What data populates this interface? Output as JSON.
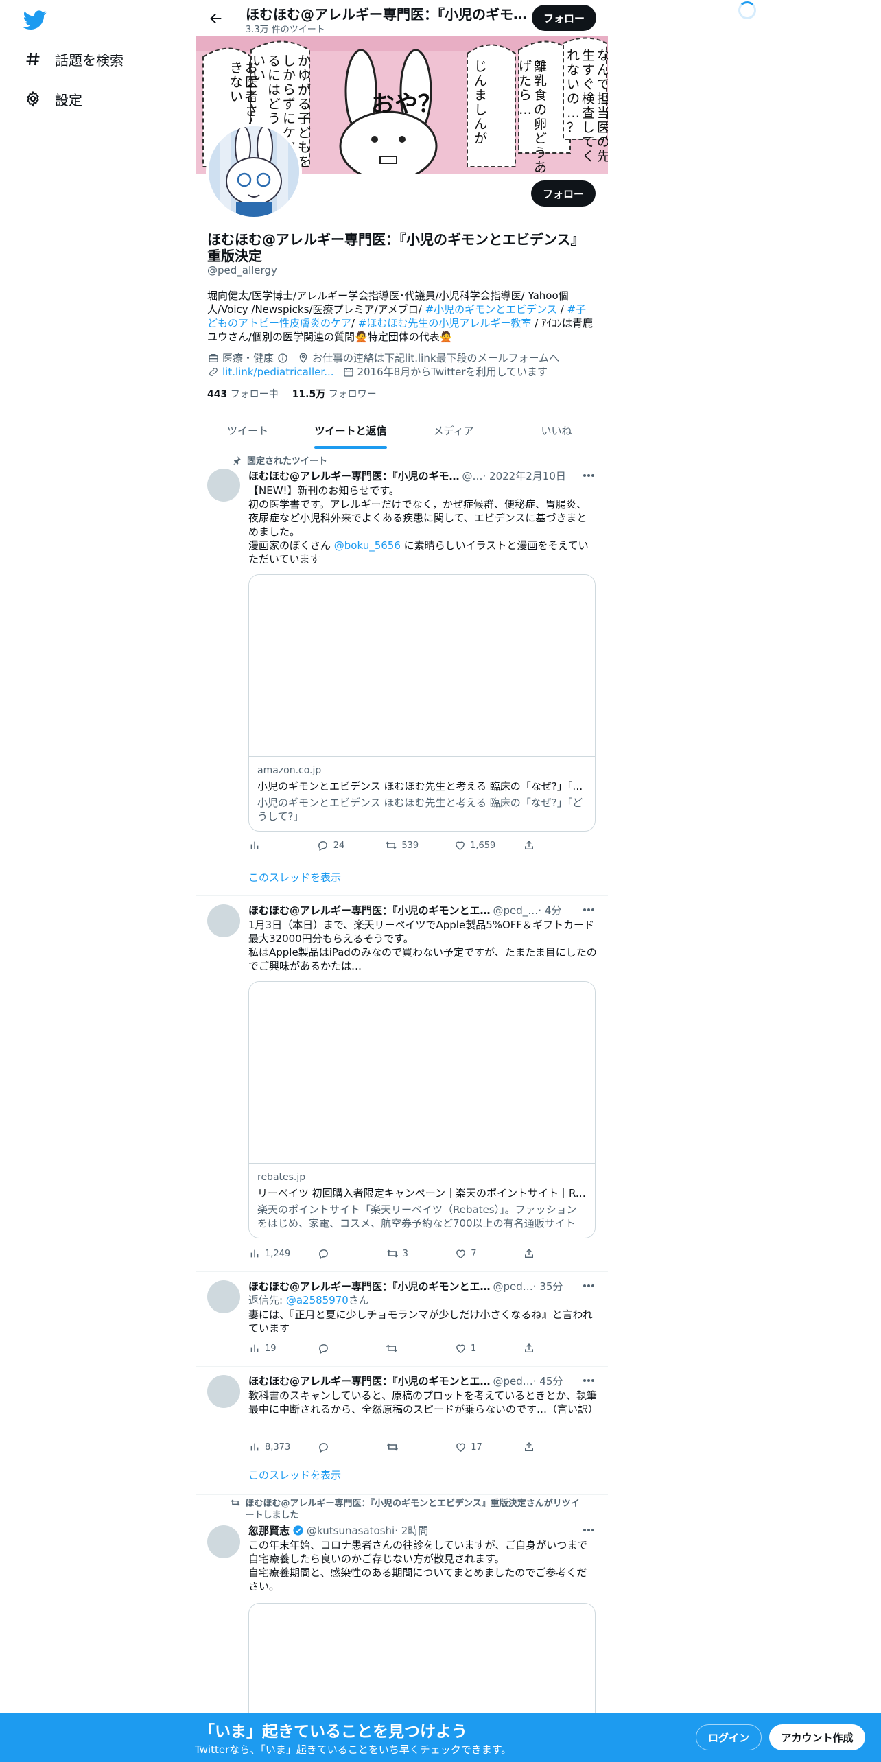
{
  "sidebar": {
    "items": [
      {
        "label": "話題を検索"
      },
      {
        "label": "設定"
      }
    ]
  },
  "topbar": {
    "name": "ほむほむ@アレルギー専門医：『小児のギモンとエビデンス』重版決定",
    "tweet_count": "3.3万 件のツイート",
    "follow_label": "フォロー"
  },
  "banner": {
    "texts": [
      "お医者さん相談できない",
      "かゆがる子どもをしからずにケアするにはどうしたらいい",
      "おや？",
      "じんましんが",
      "離乳食の卵どうあげたら…",
      "なんで担当医の先生すぐ検査してくれないの…？"
    ]
  },
  "profile": {
    "name": "ほむほむ@アレルギー専門医：『小児のギモンとエビデンス』重版決定",
    "handle": "@ped_allergy",
    "bio_1": "堀向健太/医学博士/アレルギー学会指導医･代議員/小児科学会指導医/ Yahoo個人/Voicy /Newspicks/医療プレミア/アメブロ/ ",
    "bio_tag_1": "#小児のギモンとエビデンス",
    "bio_2": " / ",
    "bio_tag_2": "#子どものアトピー性皮膚炎のケア",
    "bio_3": "/ ",
    "bio_tag_3": "#ほむほむ先生の小児アレルギー教室",
    "bio_4": " / ｱｲｺﾝは青鹿ユウさん/個別の医学関連の質問🙅特定団体の代表🙅",
    "category": "医療・健康",
    "location": "お仕事の連絡は下記lit.link最下段のメールフォームへ",
    "link": "lit.link/pediatricaller...",
    "joined": "2016年8月からTwitterを利用しています",
    "following_count": "443",
    "following_label": "フォロー中",
    "followers_count": "11.5万",
    "followers_label": "フォロワー",
    "follow_label": "フォロー"
  },
  "tabs": [
    {
      "label": "ツイート"
    },
    {
      "label": "ツイートと返信"
    },
    {
      "label": "メディア"
    },
    {
      "label": "いいね"
    }
  ],
  "tweets": [
    {
      "context": "固定されたツイート",
      "name": "ほむほむ@アレルギー専門医：『小児のギモ…",
      "handle": "@…",
      "time": " · 2022年2月10日",
      "text": "【NEW!】新刊のお知らせです。\n初の医学書です。アレルギーだけでなく，かぜ症候群、便秘症、胃腸炎、夜尿症など小児科外来でよくある疾患に関して、エビデンスに基づきまとめました。\n漫画家のぼくさん ",
      "mention": "@boku_5656",
      "text_after": " に素晴らしいイラストと漫画をそえていただいています",
      "card": {
        "domain": "amazon.co.jp",
        "title": "小児のギモンとエビデンス ほむほむ先生と考える 臨床の「なぜ?」「どうして?」",
        "desc": "小児のギモンとエビデンス ほむほむ先生と考える 臨床の「なぜ?」「どうして?」"
      },
      "actions": {
        "views": "",
        "replies": "24",
        "retweets": "539",
        "likes": "1,659"
      },
      "thread_link": "このスレッドを表示"
    },
    {
      "name": "ほむほむ@アレルギー専門医：『小児のギモンとエ…",
      "handle": "@ped_…",
      "time": " · 4分",
      "text": "1月3日（本日）まで、楽天リーベイツでApple製品5%OFF＆ギフトカード最大32000円分もらえるそうです。\n私はApple製品はiPadのみなので買わない予定ですが、たまたま目にしたのでご興味があるかたは…",
      "card": {
        "domain": "rebates.jp",
        "title": "リーベイツ 初回購入者限定キャンペーン｜楽天のポイントサイト｜Rebates",
        "desc": "楽天のポイントサイト「楽天リーベイツ（Rebates）」。ファッションをはじめ、家電、コスメ、航空券予約など700以上の有名通販サイトや…"
      },
      "actions": {
        "views": "1,249",
        "replies": "",
        "retweets": "3",
        "likes": "7"
      }
    },
    {
      "name": "ほむほむ@アレルギー専門医：『小児のギモンとエ…",
      "handle": "@ped…",
      "time": " · 35分",
      "reply_to_label": "返信先: ",
      "reply_to": "@a2585970",
      "reply_suffix": "さん",
      "text": "妻には、『正月と夏に少しチョモランマが少しだけ小さくなるね』と言われています",
      "actions": {
        "views": "19",
        "replies": "",
        "retweets": "",
        "likes": "1"
      }
    },
    {
      "name": "ほむほむ@アレルギー専門医：『小児のギモンとエ…",
      "handle": "@ped…",
      "time": " · 45分",
      "text": "教科書のスキャンしていると、原稿のプロットを考えているときとか、執筆最中に中断されるから、全然原稿のスピードが乗らないのです…（言い訳）",
      "actions": {
        "views": "8,373",
        "replies": "",
        "retweets": "",
        "likes": "17"
      },
      "thread_link": "このスレッドを表示"
    },
    {
      "context": "ほむほむ@アレルギー専門医：『小児のギモンとエビデンス』重版決定さんがリツイートしました",
      "name": "忽那賢志",
      "handle": "@kutsunasatoshi",
      "time": " · 2時間",
      "text": "この年末年始、コロナ患者さんの往診をしていますが、ご自身がいつまで自宅療養したら良いのかご存じない方が散見されます。\n自宅療養期間と、感染性のある期間についてまとめましたのでご参考ください。"
    }
  ],
  "bottom": {
    "title": "「いま」起きていることを見つけよう",
    "subtitle": "Twitterなら、「いま」起きていることをいち早くチェックできます。",
    "login": "ログイン",
    "signup": "アカウント作成"
  },
  "colors": {
    "accent": "#1d9bf0",
    "text": "#0f1419",
    "muted": "#536471",
    "banner": "#f0c2d3"
  }
}
